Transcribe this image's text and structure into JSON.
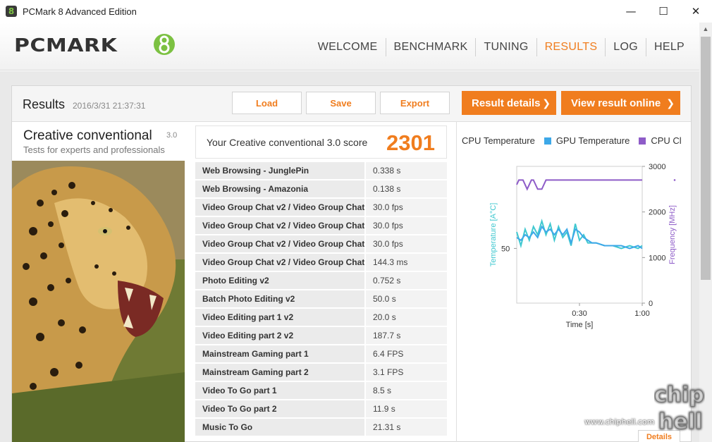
{
  "window": {
    "title": "PCMark 8 Advanced Edition",
    "icon": "8",
    "minimize": "—",
    "maximize": "☐",
    "close": "✕"
  },
  "header": {
    "logo": "PCMARK",
    "nav": [
      "WELCOME",
      "BENCHMARK",
      "TUNING",
      "RESULTS",
      "LOG",
      "HELP"
    ],
    "active": "RESULTS"
  },
  "results": {
    "title": "Results",
    "date": "2016/3/31 21:37:31",
    "load_label": "Load",
    "save_label": "Save",
    "export_label": "Export",
    "details_label": "Result details",
    "online_label": "View result online"
  },
  "benchmark": {
    "name": "Creative conventional",
    "version": "3.0",
    "subtitle": "Tests for experts and professionals",
    "score_label": "Your Creative conventional 3.0 score",
    "score": "2301"
  },
  "tests": [
    {
      "name": "Web Browsing - JunglePin",
      "value": "0.338 s"
    },
    {
      "name": "Web Browsing - Amazonia",
      "value": "0.138 s"
    },
    {
      "name": "Video Group Chat v2 / Video Group Chat",
      "value": "30.0 fps"
    },
    {
      "name": "Video Group Chat v2 / Video Group Chat",
      "value": "30.0 fps"
    },
    {
      "name": "Video Group Chat v2 / Video Group Chat",
      "value": "30.0 fps"
    },
    {
      "name": "Video Group Chat v2 / Video Group Chat",
      "value": "144.3 ms"
    },
    {
      "name": "Photo Editing v2",
      "value": "0.752 s"
    },
    {
      "name": "Batch Photo Editing v2",
      "value": "50.0 s"
    },
    {
      "name": "Video Editing part 1 v2",
      "value": "20.0 s"
    },
    {
      "name": "Video Editing part 2 v2",
      "value": "187.7 s"
    },
    {
      "name": "Mainstream Gaming part 1",
      "value": "6.4 FPS"
    },
    {
      "name": "Mainstream Gaming part 2",
      "value": "3.1 FPS"
    },
    {
      "name": "Video To Go part 1",
      "value": "8.5 s"
    },
    {
      "name": "Video To Go part 2",
      "value": "11.9 s"
    },
    {
      "name": "Music To Go",
      "value": "21.31 s"
    }
  ],
  "chart_data": {
    "type": "line",
    "legend": [
      {
        "name": "CPU Temperature",
        "color": "#40c8d0"
      },
      {
        "name": "GPU Temperature",
        "color": "#3da8e8"
      },
      {
        "name": "CPU Clc",
        "color": "#8e5cc8"
      }
    ],
    "xlabel": "Time [s]",
    "ylabel_left": "Temperature [A°C]",
    "ylabel_right": "Frequency [MHz]",
    "x_ticks": [
      "0:30",
      "1:00"
    ],
    "y_left_ticks": [
      "50"
    ],
    "y_right_ticks": [
      "3000",
      "2000",
      "1000",
      "0"
    ],
    "xlim": [
      0,
      60
    ],
    "y_right_lim": [
      0,
      3000
    ],
    "y_left_lim": [
      30,
      80
    ],
    "series": [
      {
        "name": "CPU Clc",
        "axis": "right",
        "color": "#8e5cc8",
        "x": [
          0,
          1,
          3,
          5,
          7,
          8,
          10,
          12,
          14,
          16,
          18,
          60
        ],
        "y": [
          2600,
          2700,
          2700,
          2500,
          2700,
          2700,
          2500,
          2500,
          2700,
          2700,
          2700,
          2700
        ]
      },
      {
        "name": "CPU Temperature",
        "axis": "left",
        "color": "#40c8d0",
        "x": [
          0,
          2,
          4,
          6,
          8,
          10,
          12,
          14,
          16,
          18,
          20,
          22,
          24,
          26,
          28,
          30,
          32,
          34,
          36,
          38,
          42,
          46,
          50,
          54,
          58,
          60
        ],
        "y": [
          56,
          51,
          57,
          53,
          58,
          55,
          60,
          55,
          59,
          53,
          58,
          54,
          56,
          51,
          59,
          53,
          55,
          52,
          52,
          52,
          51,
          51,
          50,
          51,
          50,
          51
        ]
      },
      {
        "name": "GPU Temperature",
        "axis": "left",
        "color": "#3da8e8",
        "x": [
          0,
          2,
          4,
          6,
          8,
          10,
          12,
          14,
          16,
          18,
          20,
          22,
          24,
          26,
          28,
          30,
          32,
          34,
          36,
          38,
          42,
          46,
          50,
          54,
          58,
          60
        ],
        "y": [
          54,
          53,
          55,
          54,
          56,
          54,
          58,
          56,
          57,
          55,
          57,
          55,
          57,
          52,
          57,
          56,
          54,
          53,
          52,
          52,
          51,
          51,
          51,
          50,
          51,
          50
        ]
      }
    ]
  },
  "details_small": "Details",
  "watermark": {
    "site": "www.chiphell.com",
    "logo": "chip hell"
  }
}
